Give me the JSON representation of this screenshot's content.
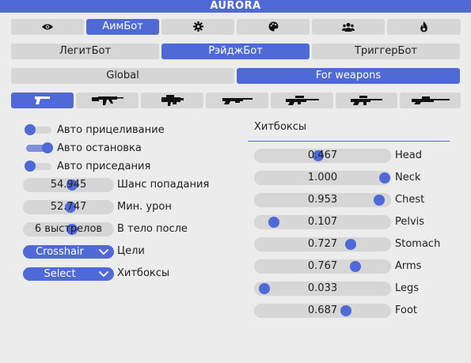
{
  "window": {
    "title": "AURORA"
  },
  "top_tabs": [
    {
      "icon": "eye-icon"
    },
    {
      "label": "АимБот"
    },
    {
      "icon": "gear-icon"
    },
    {
      "icon": "palette-icon"
    },
    {
      "icon": "users-icon"
    },
    {
      "icon": "flame-icon"
    }
  ],
  "mode_tabs": [
    "ЛегитБот",
    "РэйджБот",
    "ТриггерБот"
  ],
  "scope_tabs": [
    "Global",
    "For weapons"
  ],
  "weapon_tabs": [
    {
      "icon": "pistol-icon"
    },
    {
      "icon": "rifle-icon"
    },
    {
      "icon": "heavy-icon"
    },
    {
      "icon": "shotgun-icon"
    },
    {
      "icon": "sniper-icon"
    },
    {
      "icon": "auto-sniper-icon"
    },
    {
      "icon": "scout-icon"
    }
  ],
  "left_panel": {
    "toggles": [
      {
        "label": "Авто прицеливание",
        "on": false
      },
      {
        "label": "Авто остановка",
        "on": true
      },
      {
        "label": "Авто приседания",
        "on": false
      }
    ],
    "sliders": [
      {
        "label": "Шанс попадания",
        "value": "54.945",
        "fraction": 0.55
      },
      {
        "label": "Мин. урон",
        "value": "52.747",
        "fraction": 0.53
      },
      {
        "label": "В тело после",
        "value": "6 выстрелов",
        "fraction": 0.55
      }
    ],
    "dropdowns": [
      {
        "label": "Цели",
        "value": "Crosshair"
      },
      {
        "label": "Хитбоксы",
        "value": "Select"
      }
    ]
  },
  "right_panel": {
    "title": "Хитбоксы",
    "hitboxes": [
      {
        "name": "Head",
        "value": "0.467",
        "fraction": 0.467
      },
      {
        "name": "Neck",
        "value": "1.000",
        "fraction": 1.0
      },
      {
        "name": "Chest",
        "value": "0.953",
        "fraction": 0.953
      },
      {
        "name": "Pelvis",
        "value": "0.107",
        "fraction": 0.107
      },
      {
        "name": "Stomach",
        "value": "0.727",
        "fraction": 0.727
      },
      {
        "name": "Arms",
        "value": "0.767",
        "fraction": 0.767
      },
      {
        "name": "Legs",
        "value": "0.033",
        "fraction": 0.033
      },
      {
        "name": "Foot",
        "value": "0.687",
        "fraction": 0.687
      }
    ]
  },
  "colors": {
    "accent": "#4f6ad6",
    "inactive": "#d6d6d6",
    "background": "#ececec"
  }
}
